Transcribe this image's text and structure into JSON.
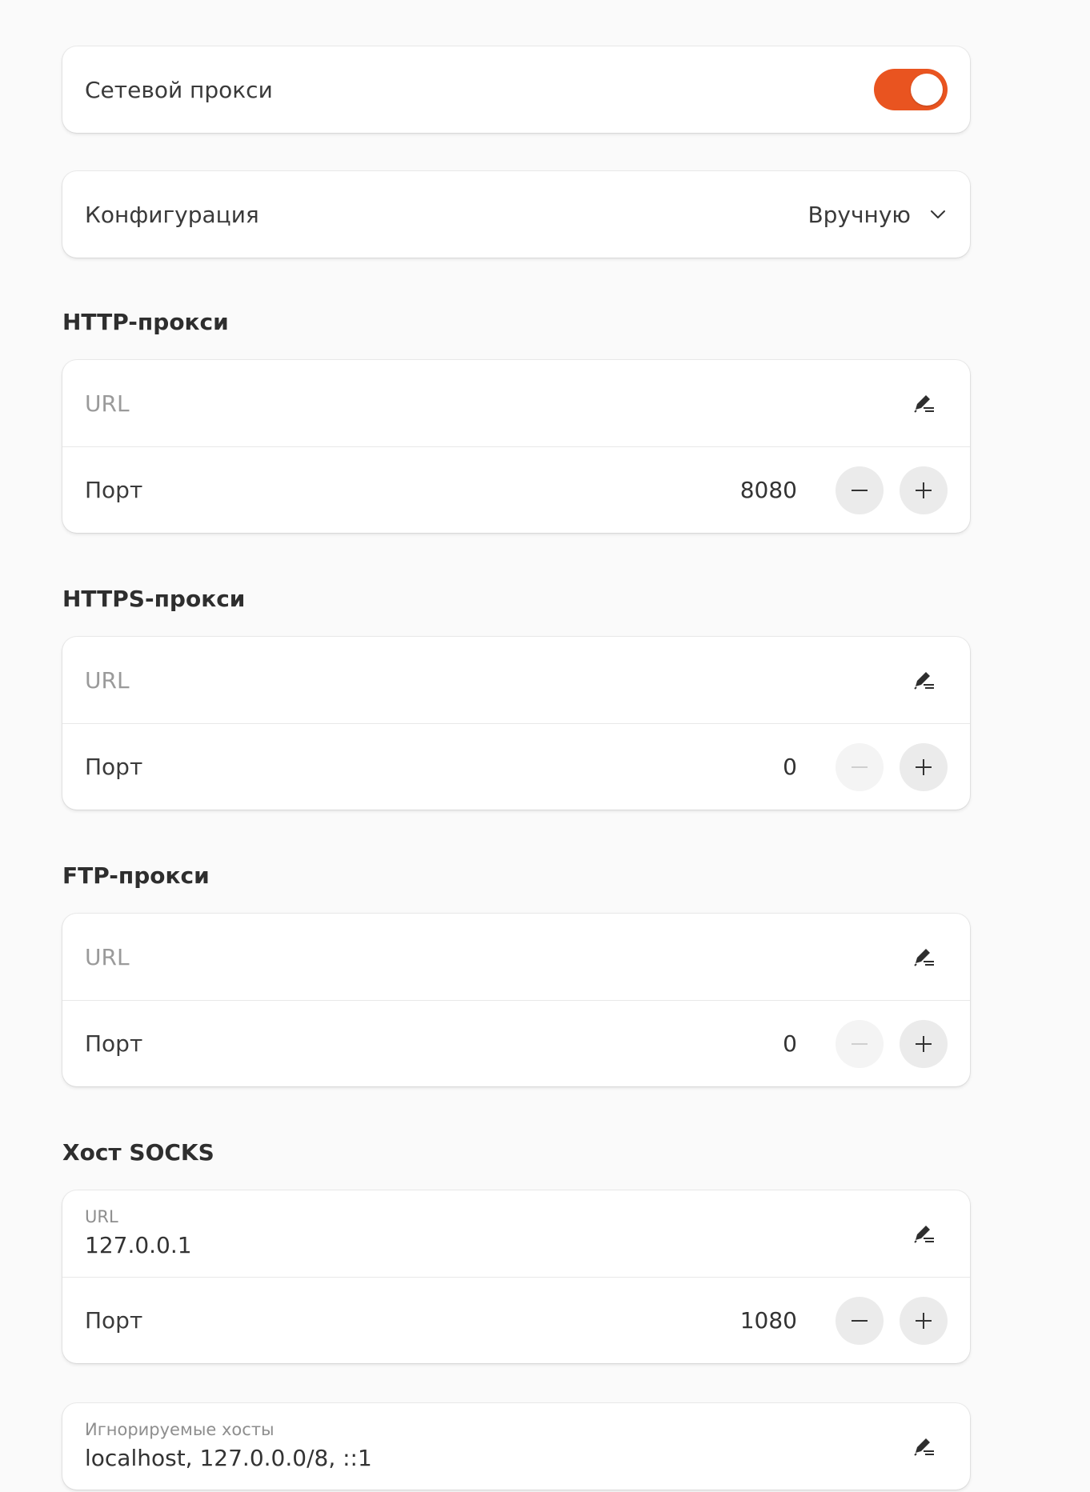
{
  "proxy_toggle": {
    "label": "Сетевой прокси",
    "enabled": true,
    "accent_color": "#e95420"
  },
  "configuration": {
    "label": "Конфигурация",
    "value": "Вручную",
    "icon": "chevron-down-icon"
  },
  "http_proxy": {
    "title": "HTTP-прокси",
    "url_placeholder": "URL",
    "port_label": "Порт",
    "port_value": "8080"
  },
  "https_proxy": {
    "title": "HTTPS-прокси",
    "url_placeholder": "URL",
    "port_label": "Порт",
    "port_value": "0"
  },
  "ftp_proxy": {
    "title": "FTP-прокси",
    "url_placeholder": "URL",
    "port_label": "Порт",
    "port_value": "0"
  },
  "socks_host": {
    "title": "Хост SOCKS",
    "url_label": "URL",
    "url_value": "127.0.0.1",
    "port_label": "Порт",
    "port_value": "1080"
  },
  "ignored_hosts": {
    "label": "Игнорируемые хосты",
    "value": "localhost, 127.0.0.0/8, ::1"
  },
  "icons": {
    "edit": "edit-pencil-icon",
    "minus": "minus-icon",
    "plus": "plus-icon"
  }
}
